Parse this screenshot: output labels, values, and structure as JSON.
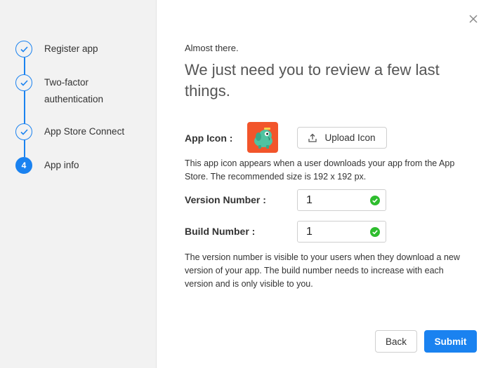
{
  "steps": [
    {
      "label": "Register app",
      "state": "done"
    },
    {
      "label": "Two-factor authentication",
      "state": "done"
    },
    {
      "label": "App Store Connect",
      "state": "done"
    },
    {
      "label": "App info",
      "state": "current",
      "number": "4"
    }
  ],
  "dialog": {
    "eyebrow": "Almost there.",
    "heading": "We just need you to review a few last things.",
    "app_icon_label": "App Icon :",
    "upload_button": "Upload Icon",
    "app_icon_help": "This app icon appears when a user downloads your app from the App Store. The recommended size is 192 x 192 px.",
    "version_label": "Version Number :",
    "version_value": "1",
    "build_label": "Build Number :",
    "build_value": "1",
    "version_help": "The version number is visible to your users when they download a new version of your app. The build number needs to increase with each version and is only visible to you.",
    "back_button": "Back",
    "submit_button": "Submit"
  },
  "icons": {
    "close": "close-icon",
    "upload": "upload-icon",
    "step_done": "check-icon",
    "valid": "check-circle-icon",
    "app": "app-mascot-icon"
  },
  "colors": {
    "accent": "#1a82f0",
    "success": "#2ebd2e",
    "app_icon_bg": "#f2552b",
    "sidebar_bg": "#f2f2f2"
  }
}
